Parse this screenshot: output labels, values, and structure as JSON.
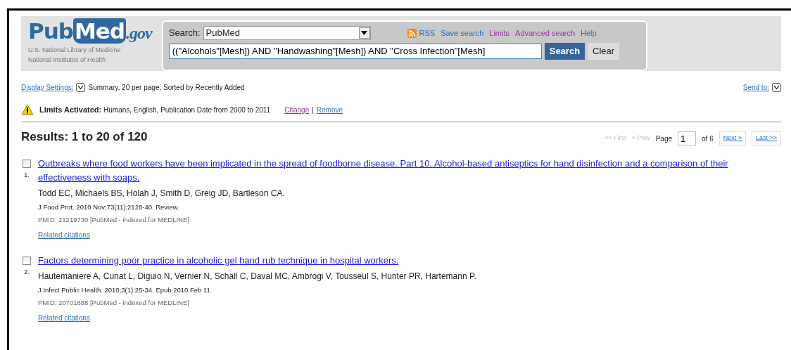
{
  "logo": {
    "word_1": "Pub",
    "word_2": "Med",
    "suffix": ".gov",
    "line_1": "U.S. National Library of Medicine",
    "line_2": "National Institutes of Health"
  },
  "search": {
    "label": "Search:",
    "database": "PubMed",
    "query": "((\"Alcohols\"[Mesh]) AND \"Handwashing\"[Mesh]) AND \"Cross Infection\"[Mesh]",
    "buttons": [
      "Search",
      "Clear"
    ],
    "links": [
      {
        "label": "RSS",
        "kind": "rss",
        "visited": false
      },
      {
        "label": "Save search",
        "kind": "plain",
        "visited": false
      },
      {
        "label": "Limits",
        "kind": "plain",
        "visited": true
      },
      {
        "label": "Advanced search",
        "kind": "plain",
        "visited": true
      },
      {
        "label": "Help",
        "kind": "plain",
        "visited": false
      }
    ]
  },
  "display": {
    "link": "Display Settings:",
    "summary": "Summary, 20 per page, Sorted by Recently Added",
    "send_to": "Send to:"
  },
  "limits": {
    "title": "Limits Activated:",
    "text": "Humans, English, Publication Date from 2000 to 2011",
    "links": [
      {
        "label": "Change",
        "visited": true
      },
      {
        "label": "Remove",
        "visited": false
      }
    ],
    "separator": "|"
  },
  "results": {
    "heading": "Results: 1 to 20 of 120",
    "pager": {
      "first": {
        "label": "<< First",
        "disabled": true
      },
      "prev": {
        "label": "< Prev",
        "disabled": true
      },
      "page_label": "Page",
      "page": "1",
      "of": "of 6",
      "next": {
        "label": "Next >",
        "disabled": false
      },
      "last": {
        "label": "Last >>",
        "disabled": false
      }
    },
    "items": [
      {
        "number": "1.",
        "checked": false,
        "title": "Outbreaks where food workers have been implicated in the spread of foodborne disease. Part 10. Alcohol-based antiseptics for hand disinfection and a comparison of their effectiveness with soaps.",
        "authors": "Todd EC, Michaels BS, Holah J, Smith D, Greig JD, Bartleson CA.",
        "journal": "J Food Prot. 2010 Nov;73(11):2128-40. Review.",
        "pmid": "PMID: 21219730 [PubMed - indexed for MEDLINE]",
        "related": "Related citations"
      },
      {
        "number": "2.",
        "checked": false,
        "title": "Factors determining poor practice in alcoholic gel hand rub technique in hospital workers.",
        "authors": "Hautemaniere A, Cunat L, Diguio N, Vernier N, Schall C, Daval MC, Ambrogi V, Tousseul S, Hunter PR, Hartemann P.",
        "journal": "J Infect Public Health. 2010;3(1):25-34. Epub 2010 Feb 11.",
        "pmid": "PMID: 20701888 [PubMed - indexed for MEDLINE]",
        "related": "Related citations"
      }
    ]
  }
}
